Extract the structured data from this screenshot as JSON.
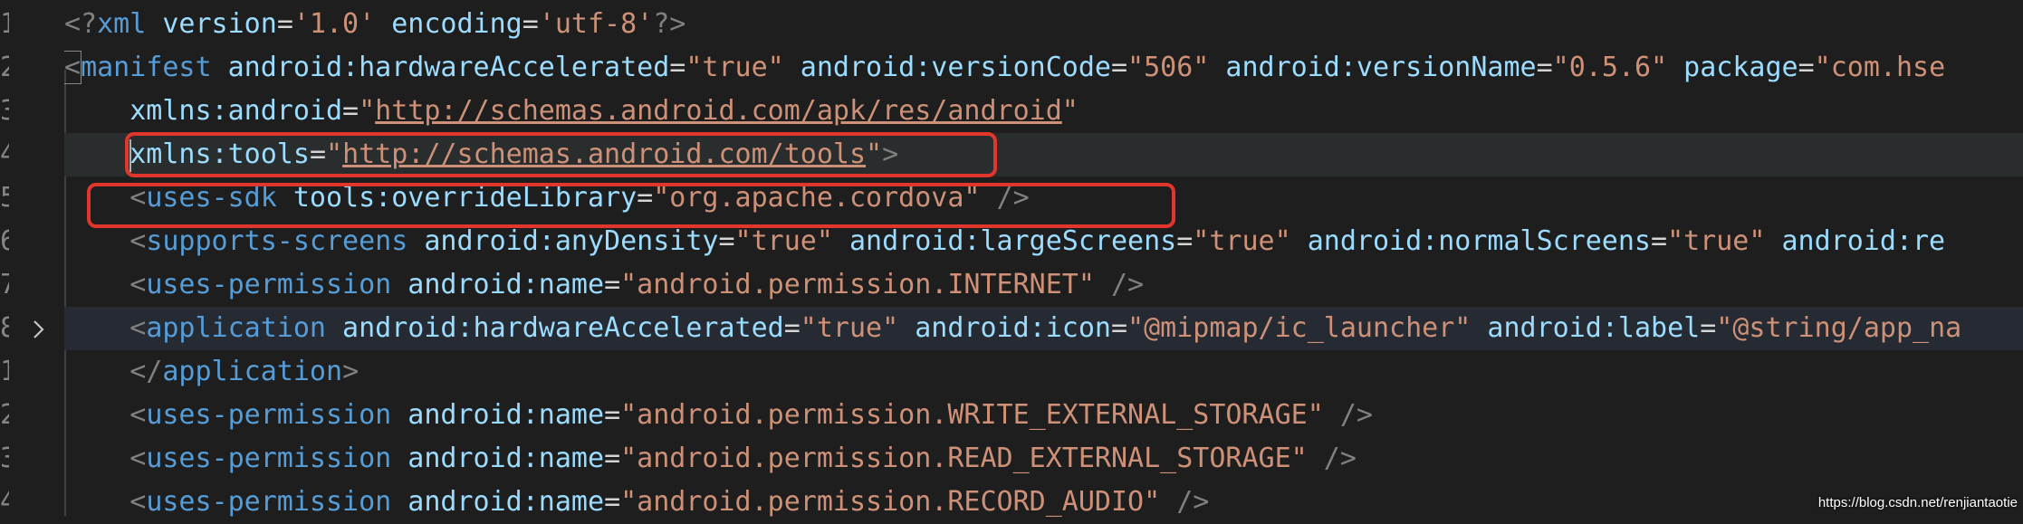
{
  "editor": {
    "line_numbers": [
      "1",
      "2",
      "3",
      "4",
      "5",
      "6",
      "7",
      "8",
      "1",
      "2",
      "3",
      "4"
    ],
    "lines": [
      {
        "tokens": [
          [
            "c-punct",
            "<?"
          ],
          [
            "c-tag",
            "xml"
          ],
          [
            "c-attr",
            " version"
          ],
          [
            "c-eq",
            "="
          ],
          [
            "c-str",
            "'1.0'"
          ],
          [
            "c-attr",
            " encoding"
          ],
          [
            "c-eq",
            "="
          ],
          [
            "c-str",
            "'utf-8'"
          ],
          [
            "c-punct",
            "?>"
          ]
        ]
      },
      {
        "tokens": [
          [
            "c-punct",
            "<"
          ],
          [
            "c-tag",
            "manifest"
          ],
          [
            "c-attr",
            " android:hardwareAccelerated"
          ],
          [
            "c-eq",
            "="
          ],
          [
            "c-str",
            "\"true\""
          ],
          [
            "c-attr",
            " android:versionCode"
          ],
          [
            "c-eq",
            "="
          ],
          [
            "c-str",
            "\"506\""
          ],
          [
            "c-attr",
            " android:versionName"
          ],
          [
            "c-eq",
            "="
          ],
          [
            "c-str",
            "\"0.5.6\""
          ],
          [
            "c-attr",
            " package"
          ],
          [
            "c-eq",
            "="
          ],
          [
            "c-str",
            "\"com.hse"
          ]
        ]
      },
      {
        "tokens": [
          [
            "c-attr",
            "    xmlns:android"
          ],
          [
            "c-eq",
            "="
          ],
          [
            "c-str",
            "\""
          ],
          [
            "c-url",
            "http://schemas.android.com/apk/res/android"
          ],
          [
            "c-str",
            "\""
          ]
        ]
      },
      {
        "tokens": [
          [
            "c-attr",
            "    xmlns:tools"
          ],
          [
            "c-eq",
            "="
          ],
          [
            "c-str",
            "\""
          ],
          [
            "c-url",
            "http://schemas.android.com/tools"
          ],
          [
            "c-str",
            "\""
          ],
          [
            "c-punct",
            ">"
          ]
        ]
      },
      {
        "tokens": [
          [
            "c-punct",
            "    <"
          ],
          [
            "c-tag",
            "uses-sdk"
          ],
          [
            "c-attr",
            " tools:overrideLibrary"
          ],
          [
            "c-eq",
            "="
          ],
          [
            "c-str",
            "\"org.apache.cordova\""
          ],
          [
            "c-punct",
            " />"
          ]
        ]
      },
      {
        "tokens": [
          [
            "c-punct",
            "    <"
          ],
          [
            "c-tag",
            "supports-screens"
          ],
          [
            "c-attr",
            " android:anyDensity"
          ],
          [
            "c-eq",
            "="
          ],
          [
            "c-str",
            "\"true\""
          ],
          [
            "c-attr",
            " android:largeScreens"
          ],
          [
            "c-eq",
            "="
          ],
          [
            "c-str",
            "\"true\""
          ],
          [
            "c-attr",
            " android:normalScreens"
          ],
          [
            "c-eq",
            "="
          ],
          [
            "c-str",
            "\"true\""
          ],
          [
            "c-attr",
            " android:re"
          ]
        ]
      },
      {
        "tokens": [
          [
            "c-punct",
            "    <"
          ],
          [
            "c-tag",
            "uses-permission"
          ],
          [
            "c-attr",
            " android:name"
          ],
          [
            "c-eq",
            "="
          ],
          [
            "c-str",
            "\"android.permission.INTERNET\""
          ],
          [
            "c-punct",
            " />"
          ]
        ]
      },
      {
        "tokens": [
          [
            "c-punct",
            "    <"
          ],
          [
            "c-tag",
            "application"
          ],
          [
            "c-attr",
            " android:hardwareAccelerated"
          ],
          [
            "c-eq",
            "="
          ],
          [
            "c-str",
            "\"true\""
          ],
          [
            "c-attr",
            " android:icon"
          ],
          [
            "c-eq",
            "="
          ],
          [
            "c-str",
            "\"@mipmap/ic_launcher\""
          ],
          [
            "c-attr",
            " android:label"
          ],
          [
            "c-eq",
            "="
          ],
          [
            "c-str",
            "\"@string/app_na"
          ]
        ]
      },
      {
        "tokens": [
          [
            "c-punct",
            "    </"
          ],
          [
            "c-tag",
            "application"
          ],
          [
            "c-punct",
            ">"
          ]
        ]
      },
      {
        "tokens": [
          [
            "c-punct",
            "    <"
          ],
          [
            "c-tag",
            "uses-permission"
          ],
          [
            "c-attr",
            " android:name"
          ],
          [
            "c-eq",
            "="
          ],
          [
            "c-str",
            "\"android.permission.WRITE_EXTERNAL_STORAGE\""
          ],
          [
            "c-punct",
            " />"
          ]
        ]
      },
      {
        "tokens": [
          [
            "c-punct",
            "    <"
          ],
          [
            "c-tag",
            "uses-permission"
          ],
          [
            "c-attr",
            " android:name"
          ],
          [
            "c-eq",
            "="
          ],
          [
            "c-str",
            "\"android.permission.READ_EXTERNAL_STORAGE\""
          ],
          [
            "c-punct",
            " />"
          ]
        ]
      },
      {
        "tokens": [
          [
            "c-punct",
            "    <"
          ],
          [
            "c-tag",
            "uses-permission"
          ],
          [
            "c-attr",
            " android:name"
          ],
          [
            "c-eq",
            "="
          ],
          [
            "c-str",
            "\"android.permission.RECORD_AUDIO\""
          ],
          [
            "c-punct",
            " />"
          ]
        ]
      }
    ],
    "fold_icon": "chevron-right-icon",
    "highlight_color": "#e0362c"
  },
  "watermark": {
    "text": "https://blog.csdn.net/renjiantaotie"
  }
}
